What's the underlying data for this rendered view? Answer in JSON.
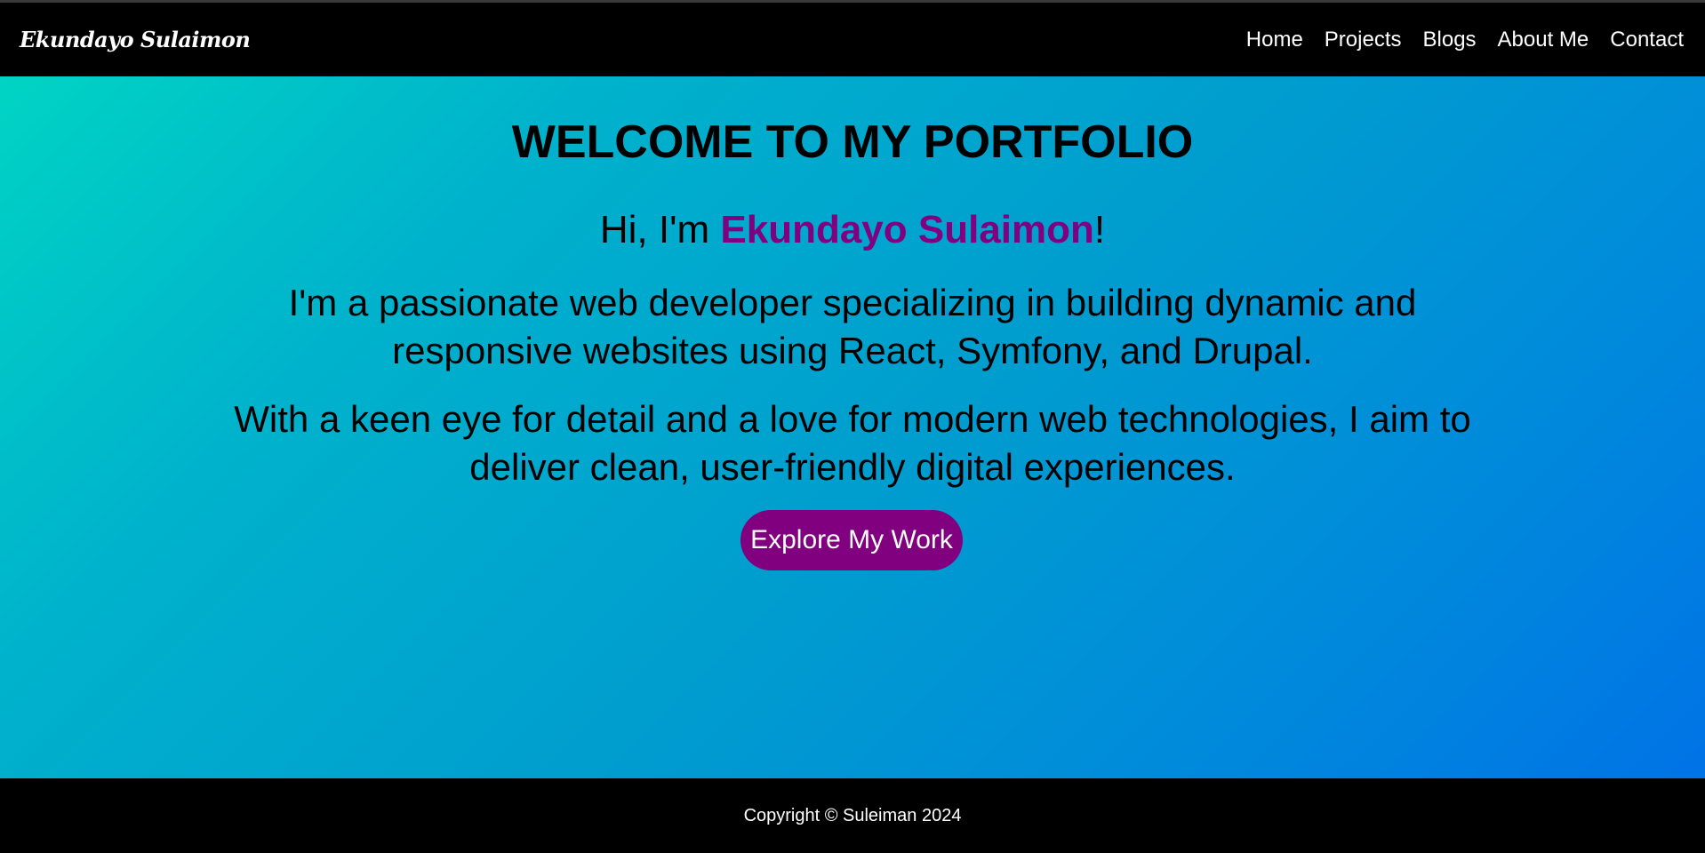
{
  "brand": "Ekundayo Sulaimon",
  "nav": {
    "home": "Home",
    "projects": "Projects",
    "blogs": "Blogs",
    "about": "About Me",
    "contact": "Contact"
  },
  "hero": {
    "title": "WELCOME TO MY PORTFOLIO",
    "intro_prefix": "Hi, I'm ",
    "intro_name": "Ekundayo Sulaimon",
    "intro_suffix": "!",
    "desc1": "I'm a passionate web developer specializing in building dynamic and responsive websites using React, Symfony,  and Drupal.",
    "desc2": "With a keen eye for detail and a love for modern web technologies, I aim to deliver clean, user-friendly digital experiences.",
    "cta_label": "Explore My Work"
  },
  "footer": {
    "copyright": "Copyright © Suleiman 2024"
  },
  "colors": {
    "accent": "#800080",
    "gradient_start": "#00d4c4",
    "gradient_end": "#0073e6",
    "bar": "#000000"
  }
}
